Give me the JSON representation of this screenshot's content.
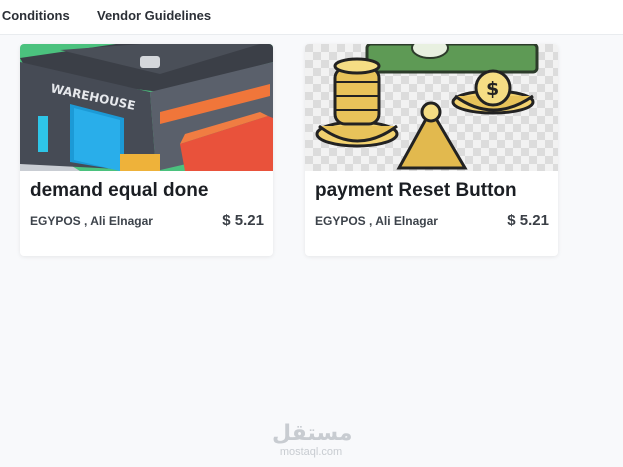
{
  "nav": {
    "items": [
      {
        "label": "s Conditions"
      },
      {
        "label": "Vendor Guidelines"
      }
    ]
  },
  "cards": [
    {
      "image_text": "WAREHOUSE",
      "title": "demand equal done",
      "vendor": "EGYPOS , Ali Elnagar",
      "price": "$ 5.21"
    },
    {
      "image_text": "$",
      "title": "payment Reset Button",
      "vendor": "EGYPOS , Ali Elnagar",
      "price": "$ 5.21"
    }
  ],
  "watermark": {
    "logo": "مستقل",
    "sub": "mostaql.com"
  },
  "colors": {
    "background": "#f8f9fb",
    "card": "#ffffff",
    "title_text": "#1b1e23",
    "gold": "#e8c35a",
    "money_green": "#4f8a4c"
  }
}
